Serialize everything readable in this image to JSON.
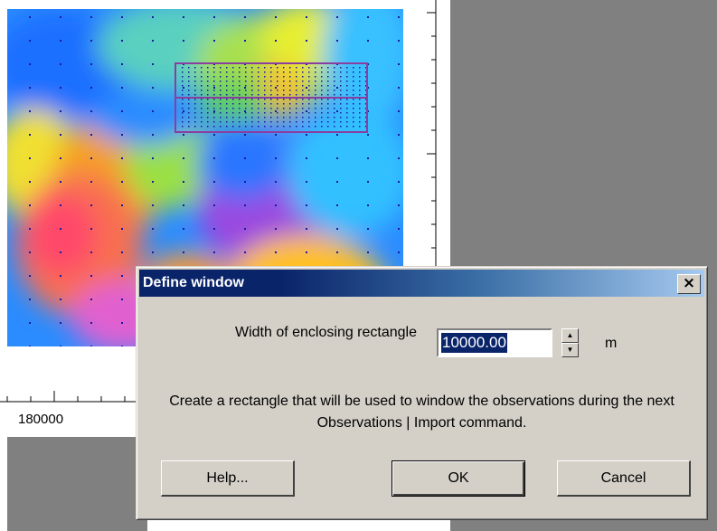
{
  "map": {
    "axis_tick_label": "180000",
    "rectangle_color": "#8a3fa0",
    "observation_dot_color": "#1a1aa0"
  },
  "dialog": {
    "title": "Define window",
    "close_glyph": "×",
    "width_label": "Width of enclosing rectangle",
    "width_value": "10000.00",
    "unit": "m",
    "description": "Create a rectangle that will be used to window the observations during the next Observations | Import command.",
    "buttons": {
      "help": "Help...",
      "ok": "OK",
      "cancel": "Cancel"
    },
    "spin_up_icon": "▲",
    "spin_down_icon": "▼"
  }
}
